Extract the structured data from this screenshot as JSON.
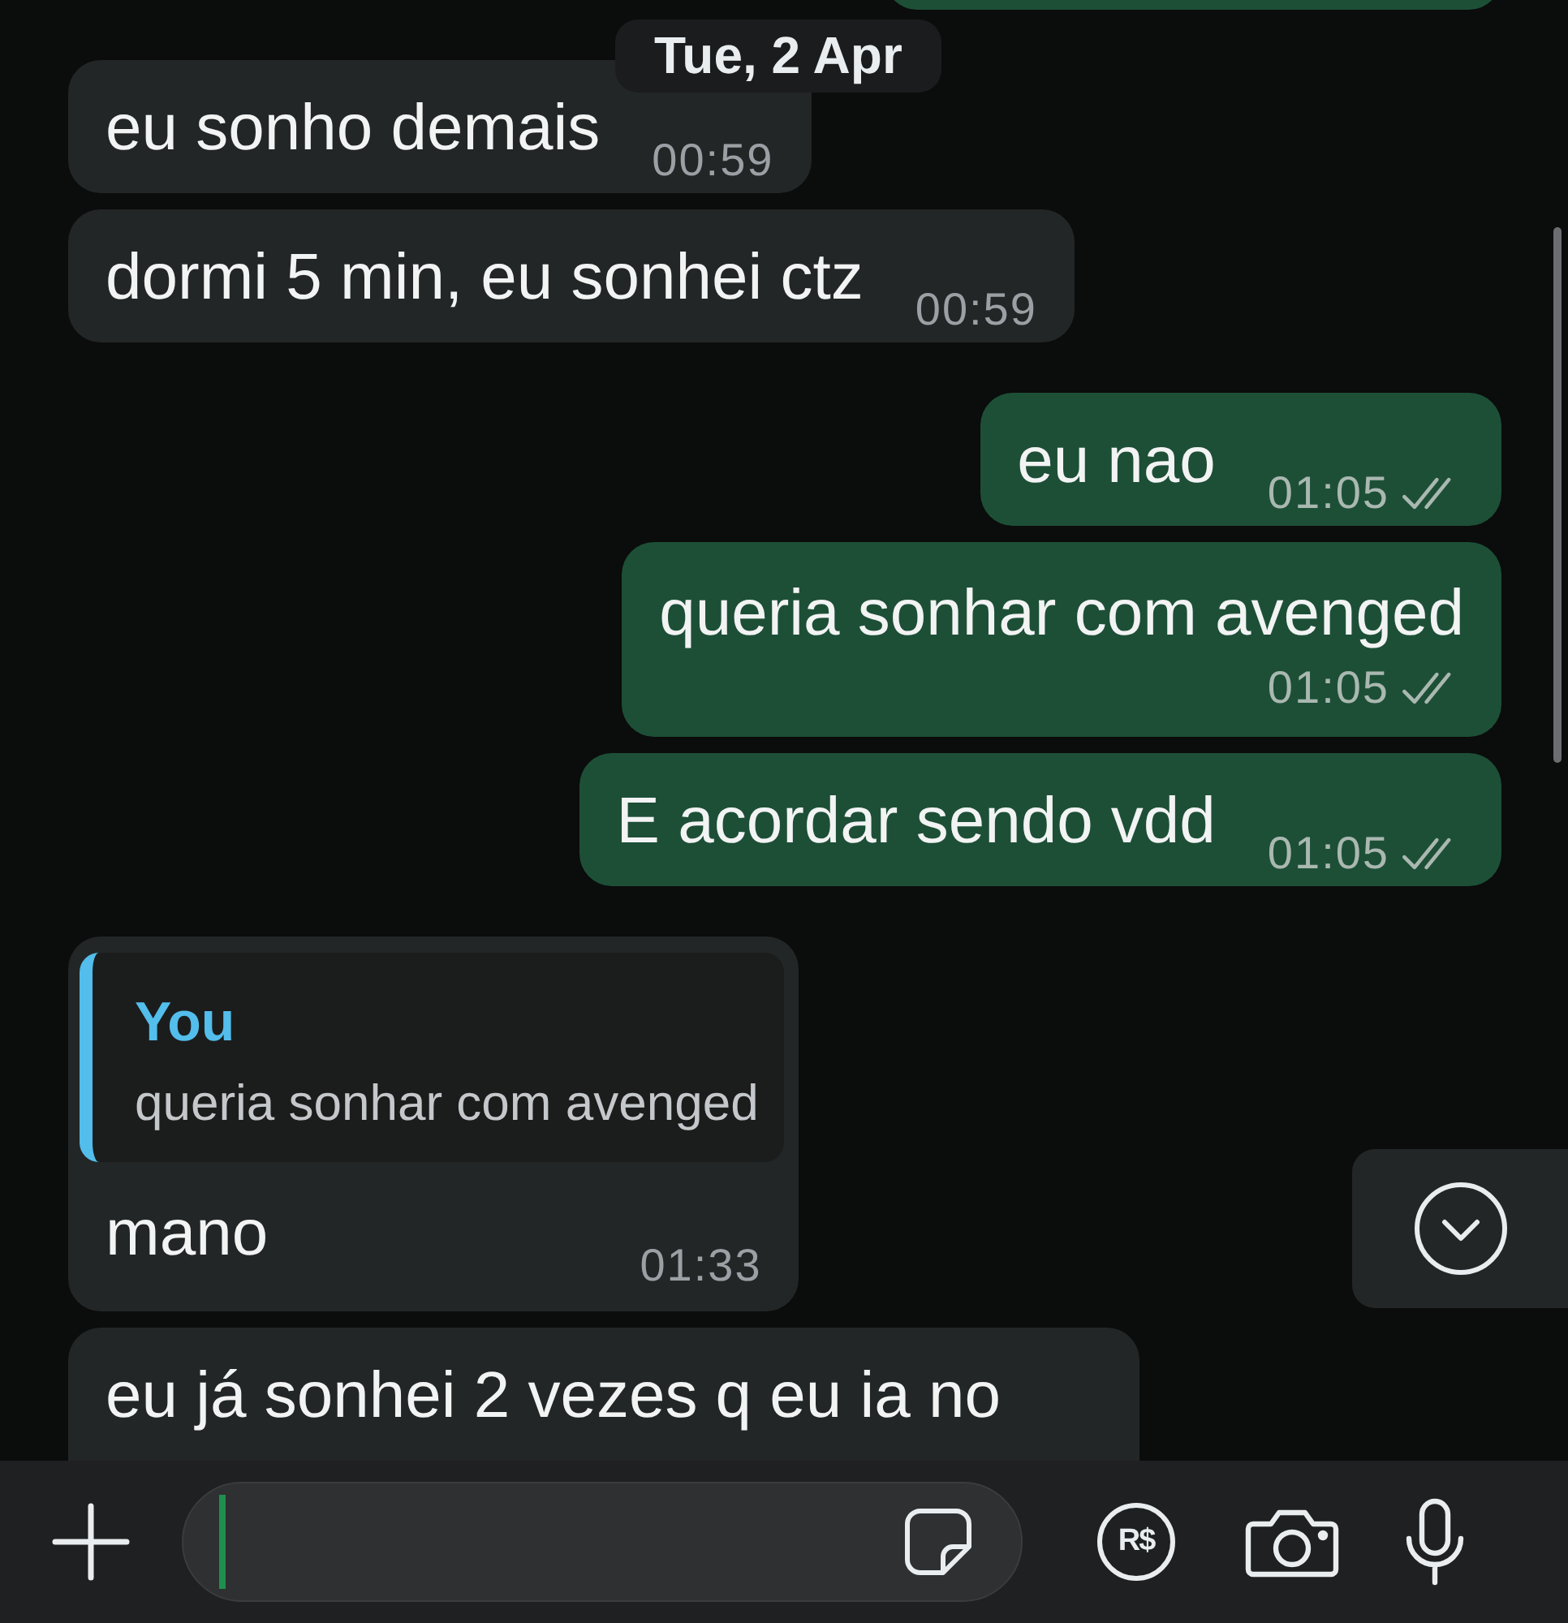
{
  "partial_bubble_above": {
    "kind": "outgoing"
  },
  "date_chip": "Tue, 2 Apr",
  "messages": [
    {
      "kind": "incoming",
      "text": "eu sonho demais",
      "time": "00:59",
      "time_below": false
    },
    {
      "kind": "incoming",
      "text": "dormi 5 min, eu sonhei ctz",
      "time": "00:59",
      "time_below": false
    },
    {
      "kind": "outgoing",
      "text": "eu nao",
      "time": "01:05",
      "read": false,
      "time_below": false
    },
    {
      "kind": "outgoing",
      "text": "queria sonhar com avenged",
      "time": "01:05",
      "read": false,
      "time_below": true
    },
    {
      "kind": "outgoing",
      "text": "E acordar sendo vdd",
      "time": "01:05",
      "read": false,
      "time_below": false
    },
    {
      "kind": "incoming",
      "quote": {
        "author": "You",
        "text": "queria sonhar com avenged"
      },
      "text": "mano",
      "time": "01:33",
      "time_below": false
    },
    {
      "kind": "incoming",
      "text": "eu já sonhei 2 vezes q eu ia no",
      "cut_off": true
    }
  ],
  "composer": {
    "payment_label": "R$"
  }
}
